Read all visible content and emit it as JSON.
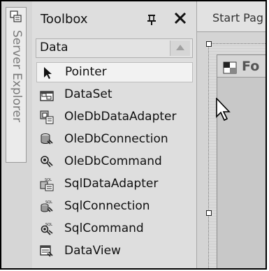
{
  "server_explorer": {
    "label": "Server Explorer"
  },
  "toolbox": {
    "title": "Toolbox",
    "category": "Data",
    "items": [
      {
        "label": "Pointer",
        "icon": "pointer-arrow-icon",
        "selected": true
      },
      {
        "label": "DataSet",
        "icon": "dataset-icon"
      },
      {
        "label": "OleDbDataAdapter",
        "icon": "oledb-data-adapter-icon"
      },
      {
        "label": "OleDbConnection",
        "icon": "oledb-connection-icon"
      },
      {
        "label": "OleDbCommand",
        "icon": "oledb-command-icon"
      },
      {
        "label": "SqlDataAdapter",
        "icon": "sql-data-adapter-icon"
      },
      {
        "label": "SqlConnection",
        "icon": "sql-connection-icon"
      },
      {
        "label": "SqlCommand",
        "icon": "sql-command-icon"
      },
      {
        "label": "DataView",
        "icon": "dataview-icon"
      }
    ]
  },
  "document": {
    "tab_label": "Start Pag",
    "form_title": "Fo"
  }
}
